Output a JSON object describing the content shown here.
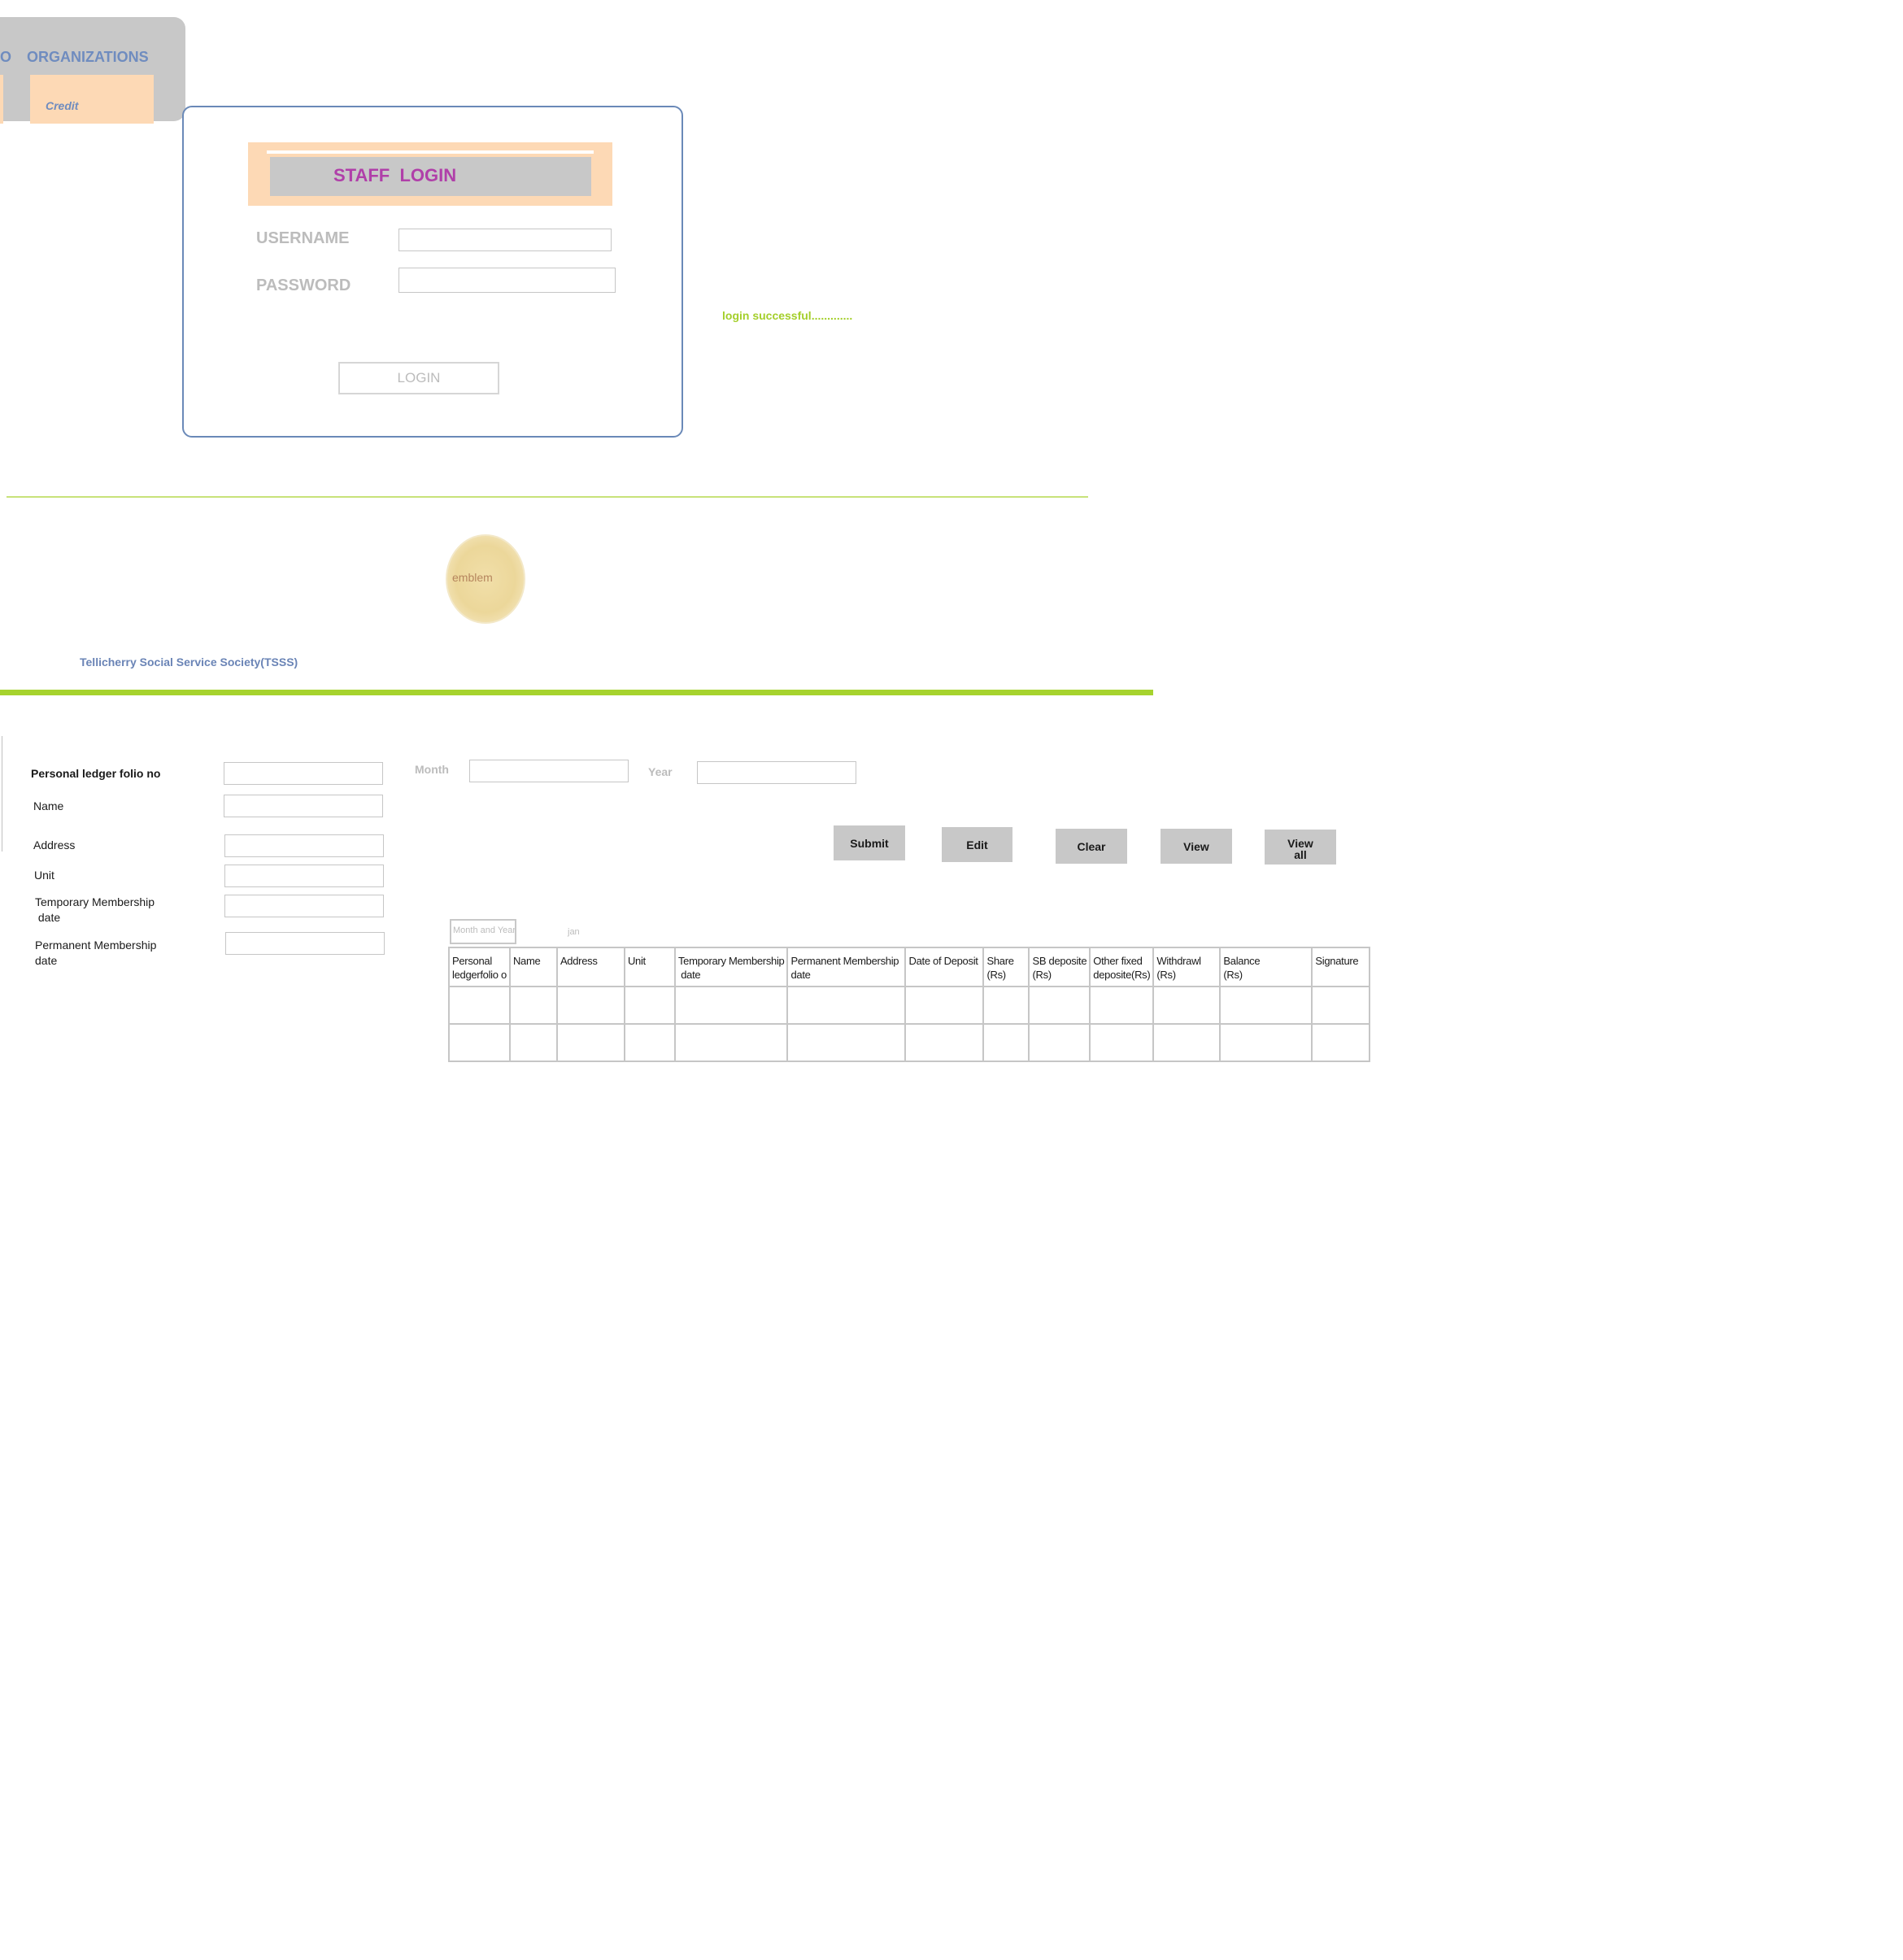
{
  "nav": {
    "partial_item": "O",
    "organizations_label": "ORGANIZATIONS",
    "credit_tile": "Credit"
  },
  "login": {
    "title": "STAFF  LOGIN",
    "username_label": "USERNAME",
    "password_label": "PASSWORD",
    "username_value": "",
    "password_value": "",
    "button_label": "LOGIN",
    "status_message": "login successful............."
  },
  "emblem": {
    "label": "emblem"
  },
  "organization": {
    "name": "Tellicherry Social Service Society(TSSS)"
  },
  "form": {
    "fields": [
      {
        "label": "Personal ledger folio no",
        "value": ""
      },
      {
        "label": "Name",
        "value": ""
      },
      {
        "label": "Address",
        "value": ""
      },
      {
        "label": "Unit",
        "value": ""
      },
      {
        "label": "Temporary Membership\n date",
        "value": ""
      },
      {
        "label": "Permanent Membership\ndate",
        "value": ""
      }
    ],
    "month_label": "Month",
    "month_value": "",
    "year_label": "Year",
    "year_value": ""
  },
  "actions": {
    "submit": "Submit",
    "edit": "Edit",
    "clear": "Clear",
    "view": "View",
    "view_all": "View\nall"
  },
  "ledger": {
    "month_year_label": "Month and Year",
    "month_value": "jan",
    "columns": [
      "Personal\nledgerfolio o",
      "Name",
      "Address",
      "Unit",
      "Temporary Membership\n date",
      "Permanent Membership\ndate",
      "Date of Deposit",
      "Share\n(Rs)",
      "SB deposite\n(Rs)",
      "Other fixed\ndeposite(Rs)",
      "Withdrawl\n(Rs)",
      "Balance\n(Rs)",
      "Signature"
    ],
    "rows": [
      [
        "",
        "",
        "",
        "",
        "",
        "",
        "",
        "",
        "",
        "",
        "",
        "",
        ""
      ],
      [
        "",
        "",
        "",
        "",
        "",
        "",
        "",
        "",
        "",
        "",
        "",
        "",
        ""
      ]
    ]
  }
}
